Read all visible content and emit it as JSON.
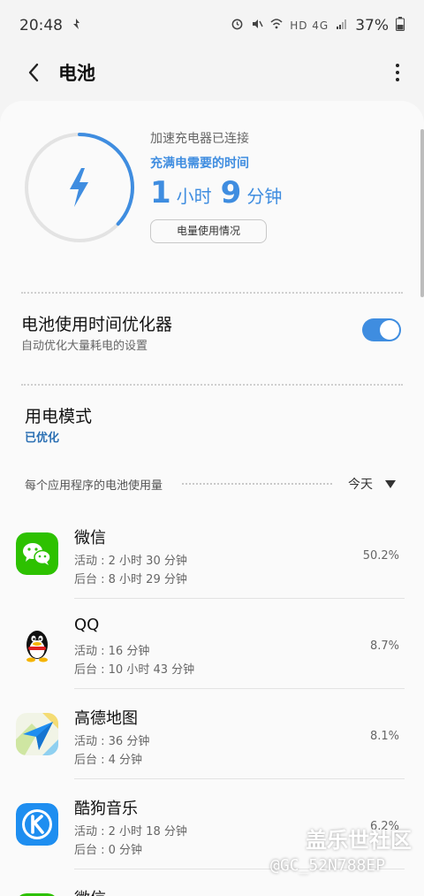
{
  "status_bar": {
    "time": "20:48",
    "network": "HD 4G",
    "battery": "37%"
  },
  "header": {
    "title": "电池"
  },
  "charging": {
    "charger_status": "加速充电器已连接",
    "time_label": "充满电需要的时间",
    "hours": "1",
    "hours_unit": "小时",
    "minutes": "9",
    "minutes_unit": "分钟",
    "usage_button": "电量使用情况",
    "ring_progress": 0.37,
    "accent_color": "#3f8de0"
  },
  "optimizer": {
    "title": "电池使用时间优化器",
    "subtitle": "自动优化大量耗电的设置",
    "enabled": true
  },
  "power_mode": {
    "title": "用电模式",
    "value": "已优化"
  },
  "usage_section": {
    "label": "每个应用程序的电池使用量",
    "period": "今天"
  },
  "apps": [
    {
      "name": "微信",
      "active": "活动 : 2 小时 30 分钟",
      "background": "后台 : 8 小时 29 分钟",
      "percent": "50.2%",
      "icon": "wechat-icon"
    },
    {
      "name": "QQ",
      "active": "活动 : 16 分钟",
      "background": "后台 : 10 小时 43 分钟",
      "percent": "8.7%",
      "icon": "qq-icon"
    },
    {
      "name": "高德地图",
      "active": "活动 : 36 分钟",
      "background": "后台 : 4 分钟",
      "percent": "8.1%",
      "icon": "amap-icon"
    },
    {
      "name": "酷狗音乐",
      "active": "活动 : 2 小时 18 分钟",
      "background": "后台 : 0 分钟",
      "percent": "6.2%",
      "icon": "kugou-icon"
    },
    {
      "name": "微信",
      "icon": "wechat-icon"
    }
  ],
  "watermark": {
    "line1": "盖乐世社区",
    "line2": "@GC_52N788EP"
  }
}
